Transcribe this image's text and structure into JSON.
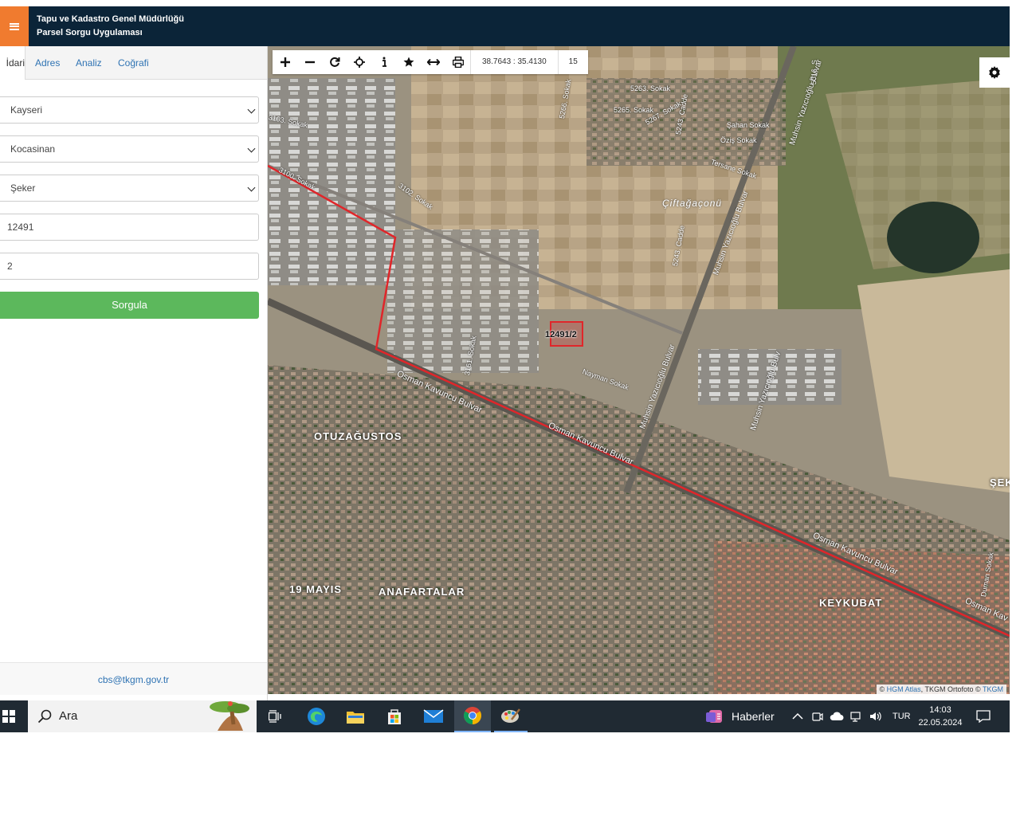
{
  "header": {
    "line1": "Tapu ve Kadastro Genel Müdürlüğü",
    "line2": "Parsel Sorgu Uygulaması"
  },
  "tabs": [
    {
      "label": "İdari"
    },
    {
      "label": "Adres"
    },
    {
      "label": "Analiz"
    },
    {
      "label": "Coğrafi"
    }
  ],
  "form": {
    "il": "Kayseri",
    "ilce": "Kocasinan",
    "mahalle": "Şeker",
    "ada": "12491",
    "parsel": "2",
    "submit": "Sorgula"
  },
  "footer": {
    "email": "cbs@tkgm.gov.tr"
  },
  "map": {
    "coordinates": "38.7643 : 35.4130",
    "zoom_level": "15",
    "parcel_label": "12491/2",
    "labels": {
      "ciftagaconu": "Çiftağaçonü",
      "otuzagustos": "OTUZAĞUSTOS",
      "ondokuzmayis": "19 MAYIS",
      "anafartalar": "ANAFARTALAR",
      "keykubat": "KEYKUBAT",
      "sek": "ŞEK",
      "osman1": "Osman Kavuncu Bulvar",
      "osman2": "Osman Kavuncu Bulvar",
      "osman3": "Osman Kavuncu Bulvar",
      "osman4": "Osman Kav",
      "muhsin1": "Muhsin Yazıcıoğlu Bulvar",
      "muhsin2": "Muhsin Yazıcıoğlu Bulvar",
      "muhsin3": "Muhsin Yazıcıoğlu Bulvar",
      "muhsin4": "Muhsin Yazıcıoğlu Bulv",
      "cadde5243a": "5243. Cadde",
      "cadde5243b": "5243. Cadde",
      "s5263": "5263. Sokak",
      "s5265": "5265. Sokak",
      "s5266": "5266. Sokak",
      "s5267": "5267. Sokak",
      "sahan": "Şahan Sokak",
      "ozis": "Öziş Sokak",
      "tersane": "Tersane Sokak",
      "s3103": "3103. Sokak",
      "s3100": "3100. Sokak",
      "s3102": "3102. Sokak",
      "s3161": "3161. Sokak",
      "nayman": "Nayman Sokak",
      "s5016": "5016. S",
      "duman": "Duman Sokak"
    },
    "attribution": {
      "prefix": "©",
      "link1": "HGM Atlas",
      "middle": ", TKGM Ortofoto ©",
      "link2": "TKGM"
    }
  },
  "taskbar": {
    "search_placeholder": "Ara",
    "news": "Haberler",
    "lang": "TUR",
    "time": "14:03",
    "date": "22.05.2024"
  },
  "colors": {
    "header_bg": "#0b2438",
    "menu_button": "#f07b2f",
    "submit_button": "#5cb85c",
    "boundary_line": "#e0262a",
    "link": "#2f73b3"
  }
}
